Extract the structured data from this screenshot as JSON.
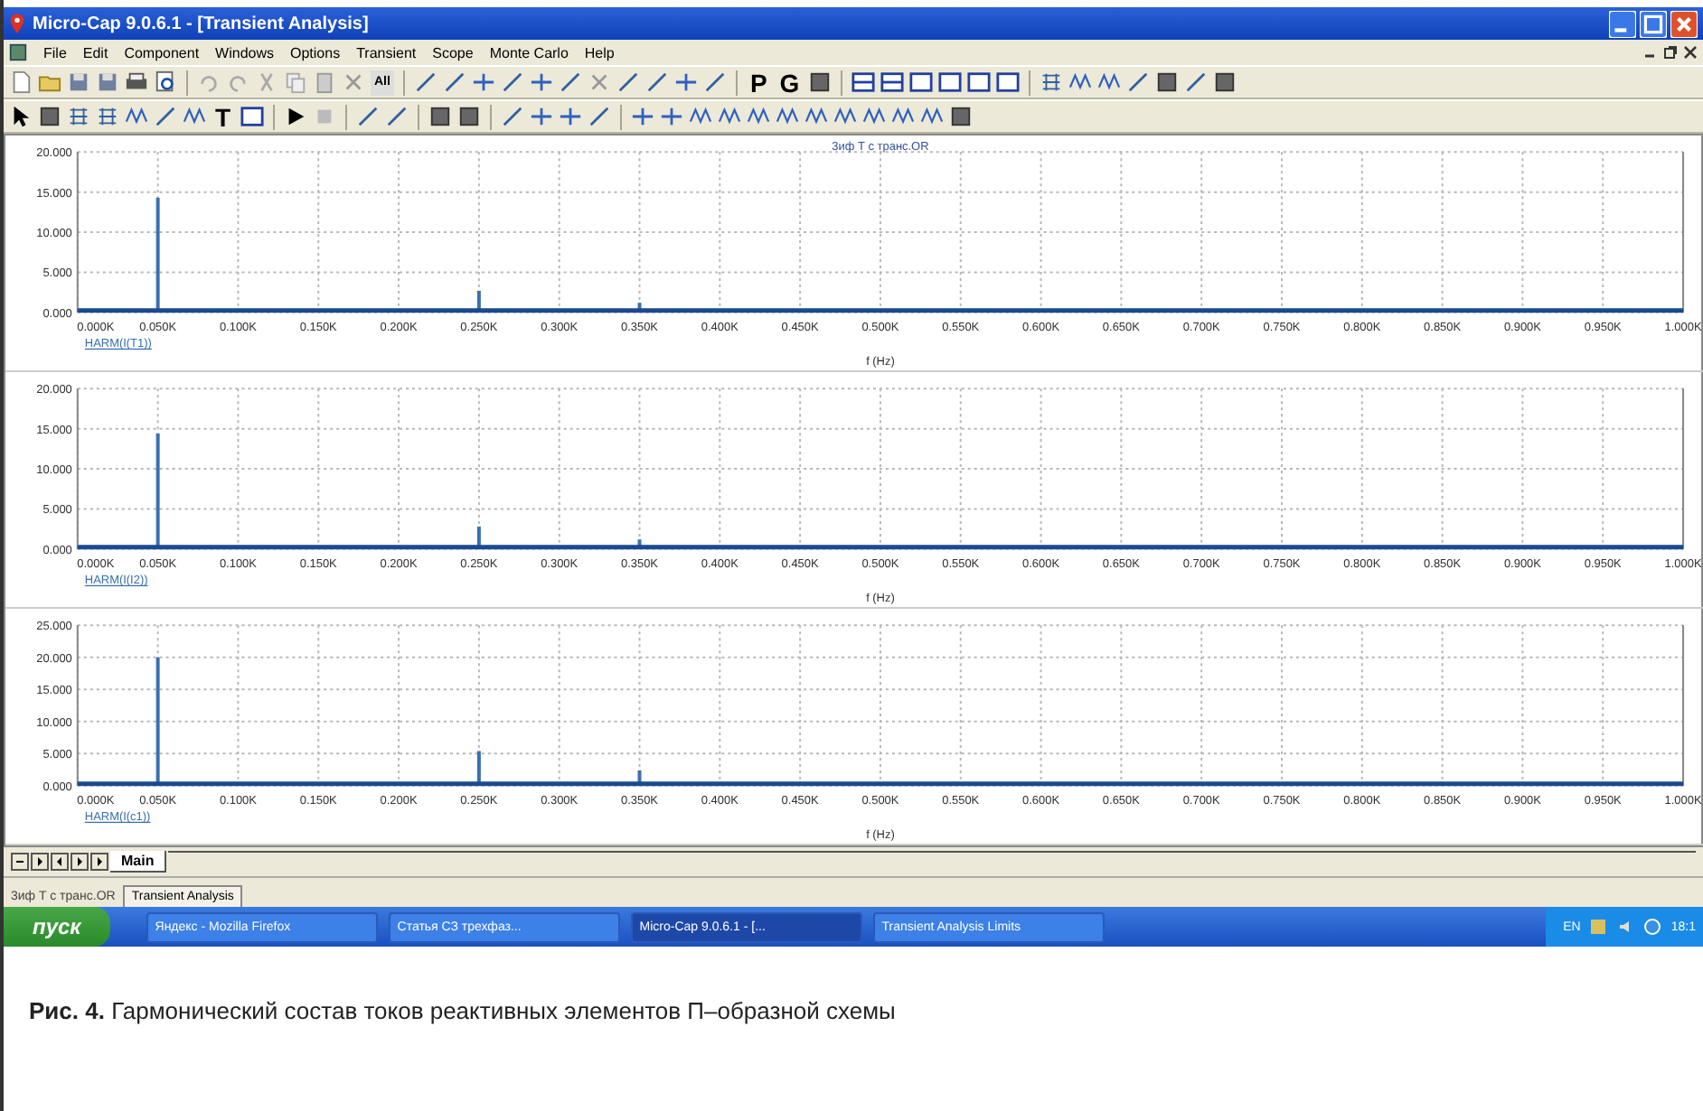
{
  "window": {
    "title": "Micro-Cap 9.0.6.1 - [Transient Analysis]"
  },
  "menu": [
    "File",
    "Edit",
    "Component",
    "Windows",
    "Options",
    "Transient",
    "Scope",
    "Monte Carlo",
    "Help"
  ],
  "toolbar_1": {
    "text_buttons": [
      "All",
      "P",
      "G"
    ]
  },
  "toolbar_2": {
    "text_buttons": [
      "T"
    ]
  },
  "plots": [
    {
      "chart_data": {
        "type": "bar",
        "title": "3иф Т с транс.OR",
        "xlabel": "f (Hz)",
        "grid": true,
        "x": [
          0.05,
          0.25,
          0.35
        ],
        "series": [
          {
            "name": "HARM(I(T1))",
            "color": "#3a70b0",
            "values": [
              14.3,
              2.7,
              1.2
            ]
          }
        ],
        "xlim": [
          0,
          1
        ],
        "ylim": [
          0,
          20
        ],
        "yticks": [
          {
            "value": 0,
            "label": "0.000"
          },
          {
            "value": 5,
            "label": "5.000"
          },
          {
            "value": 10,
            "label": "10.000"
          },
          {
            "value": 15,
            "label": "15.000"
          },
          {
            "value": 20,
            "label": "20.000"
          }
        ],
        "xticks": [
          {
            "value": 0,
            "label": "0.000K"
          },
          {
            "value": 0.05,
            "label": "0.050K"
          },
          {
            "value": 0.1,
            "label": "0.100K"
          },
          {
            "value": 0.15,
            "label": "0.150K"
          },
          {
            "value": 0.2,
            "label": "0.200K"
          },
          {
            "value": 0.25,
            "label": "0.250K"
          },
          {
            "value": 0.3,
            "label": "0.300K"
          },
          {
            "value": 0.35,
            "label": "0.350K"
          },
          {
            "value": 0.4,
            "label": "0.400K"
          },
          {
            "value": 0.45,
            "label": "0.450K"
          },
          {
            "value": 0.5,
            "label": "0.500K"
          },
          {
            "value": 0.55,
            "label": "0.550K"
          },
          {
            "value": 0.6,
            "label": "0.600K"
          },
          {
            "value": 0.65,
            "label": "0.650K"
          },
          {
            "value": 0.7,
            "label": "0.700K"
          },
          {
            "value": 0.75,
            "label": "0.750K"
          },
          {
            "value": 0.8,
            "label": "0.800K"
          },
          {
            "value": 0.85,
            "label": "0.850K"
          },
          {
            "value": 0.9,
            "label": "0.900K"
          },
          {
            "value": 0.95,
            "label": "0.950K"
          },
          {
            "value": 1,
            "label": "1.000K"
          }
        ]
      }
    },
    {
      "chart_data": {
        "type": "bar",
        "xlabel": "f (Hz)",
        "grid": true,
        "x": [
          0.05,
          0.25,
          0.35
        ],
        "series": [
          {
            "name": "HARM(I(I2))",
            "color": "#3a70b0",
            "values": [
              14.4,
              2.8,
              1.2
            ]
          }
        ],
        "xlim": [
          0,
          1
        ],
        "ylim": [
          0,
          20
        ],
        "yticks": [
          {
            "value": 0,
            "label": "0.000"
          },
          {
            "value": 5,
            "label": "5.000"
          },
          {
            "value": 10,
            "label": "10.000"
          },
          {
            "value": 15,
            "label": "15.000"
          },
          {
            "value": 20,
            "label": "20.000"
          }
        ],
        "xticks": [
          {
            "value": 0,
            "label": "0.000K"
          },
          {
            "value": 0.05,
            "label": "0.050K"
          },
          {
            "value": 0.1,
            "label": "0.100K"
          },
          {
            "value": 0.15,
            "label": "0.150K"
          },
          {
            "value": 0.2,
            "label": "0.200K"
          },
          {
            "value": 0.25,
            "label": "0.250K"
          },
          {
            "value": 0.3,
            "label": "0.300K"
          },
          {
            "value": 0.35,
            "label": "0.350K"
          },
          {
            "value": 0.4,
            "label": "0.400K"
          },
          {
            "value": 0.45,
            "label": "0.450K"
          },
          {
            "value": 0.5,
            "label": "0.500K"
          },
          {
            "value": 0.55,
            "label": "0.550K"
          },
          {
            "value": 0.6,
            "label": "0.600K"
          },
          {
            "value": 0.65,
            "label": "0.650K"
          },
          {
            "value": 0.7,
            "label": "0.700K"
          },
          {
            "value": 0.75,
            "label": "0.750K"
          },
          {
            "value": 0.8,
            "label": "0.800K"
          },
          {
            "value": 0.85,
            "label": "0.850K"
          },
          {
            "value": 0.9,
            "label": "0.900K"
          },
          {
            "value": 0.95,
            "label": "0.950K"
          },
          {
            "value": 1,
            "label": "1.000K"
          }
        ]
      }
    },
    {
      "chart_data": {
        "type": "bar",
        "xlabel": "f (Hz)",
        "grid": true,
        "x": [
          0.05,
          0.25,
          0.35
        ],
        "series": [
          {
            "name": "HARM(I(c1))",
            "color": "#3a70b0",
            "values": [
              20.0,
              5.4,
              2.4
            ]
          }
        ],
        "xlim": [
          0,
          1
        ],
        "ylim": [
          0,
          25
        ],
        "yticks": [
          {
            "value": 0,
            "label": "0.000"
          },
          {
            "value": 5,
            "label": "5.000"
          },
          {
            "value": 10,
            "label": "10.000"
          },
          {
            "value": 15,
            "label": "15.000"
          },
          {
            "value": 20,
            "label": "20.000"
          },
          {
            "value": 25,
            "label": "25.000"
          }
        ],
        "xticks": [
          {
            "value": 0,
            "label": "0.000K"
          },
          {
            "value": 0.05,
            "label": "0.050K"
          },
          {
            "value": 0.1,
            "label": "0.100K"
          },
          {
            "value": 0.15,
            "label": "0.150K"
          },
          {
            "value": 0.2,
            "label": "0.200K"
          },
          {
            "value": 0.25,
            "label": "0.250K"
          },
          {
            "value": 0.3,
            "label": "0.300K"
          },
          {
            "value": 0.35,
            "label": "0.350K"
          },
          {
            "value": 0.4,
            "label": "0.400K"
          },
          {
            "value": 0.45,
            "label": "0.450K"
          },
          {
            "value": 0.5,
            "label": "0.500K"
          },
          {
            "value": 0.55,
            "label": "0.550K"
          },
          {
            "value": 0.6,
            "label": "0.600K"
          },
          {
            "value": 0.65,
            "label": "0.650K"
          },
          {
            "value": 0.7,
            "label": "0.700K"
          },
          {
            "value": 0.75,
            "label": "0.750K"
          },
          {
            "value": 0.8,
            "label": "0.800K"
          },
          {
            "value": 0.85,
            "label": "0.850K"
          },
          {
            "value": 0.9,
            "label": "0.900K"
          },
          {
            "value": 0.95,
            "label": "0.950K"
          },
          {
            "value": 1,
            "label": "1.000K"
          }
        ]
      }
    }
  ],
  "page_tabs": [
    {
      "label": "Main",
      "selected": true
    }
  ],
  "analysis_tabs": [
    {
      "label": "3иф T с транс.OR",
      "selected": false
    },
    {
      "label": "Transient Analysis",
      "selected": true
    }
  ],
  "taskbar": {
    "start": "пуск",
    "items": [
      {
        "label": "Яндекс - Mozilla Firefox",
        "selected": false
      },
      {
        "label": "Статья СЗ трехфаз...",
        "selected": false
      },
      {
        "label": "Micro-Cap 9.0.6.1 - [...",
        "selected": true
      },
      {
        "label": "Transient Analysis Limits",
        "selected": false
      }
    ],
    "language": "EN",
    "clock": "18:1"
  },
  "caption": "**Рис. 4.** Гармонический состав токов реактивных элементов П–образной схемы"
}
